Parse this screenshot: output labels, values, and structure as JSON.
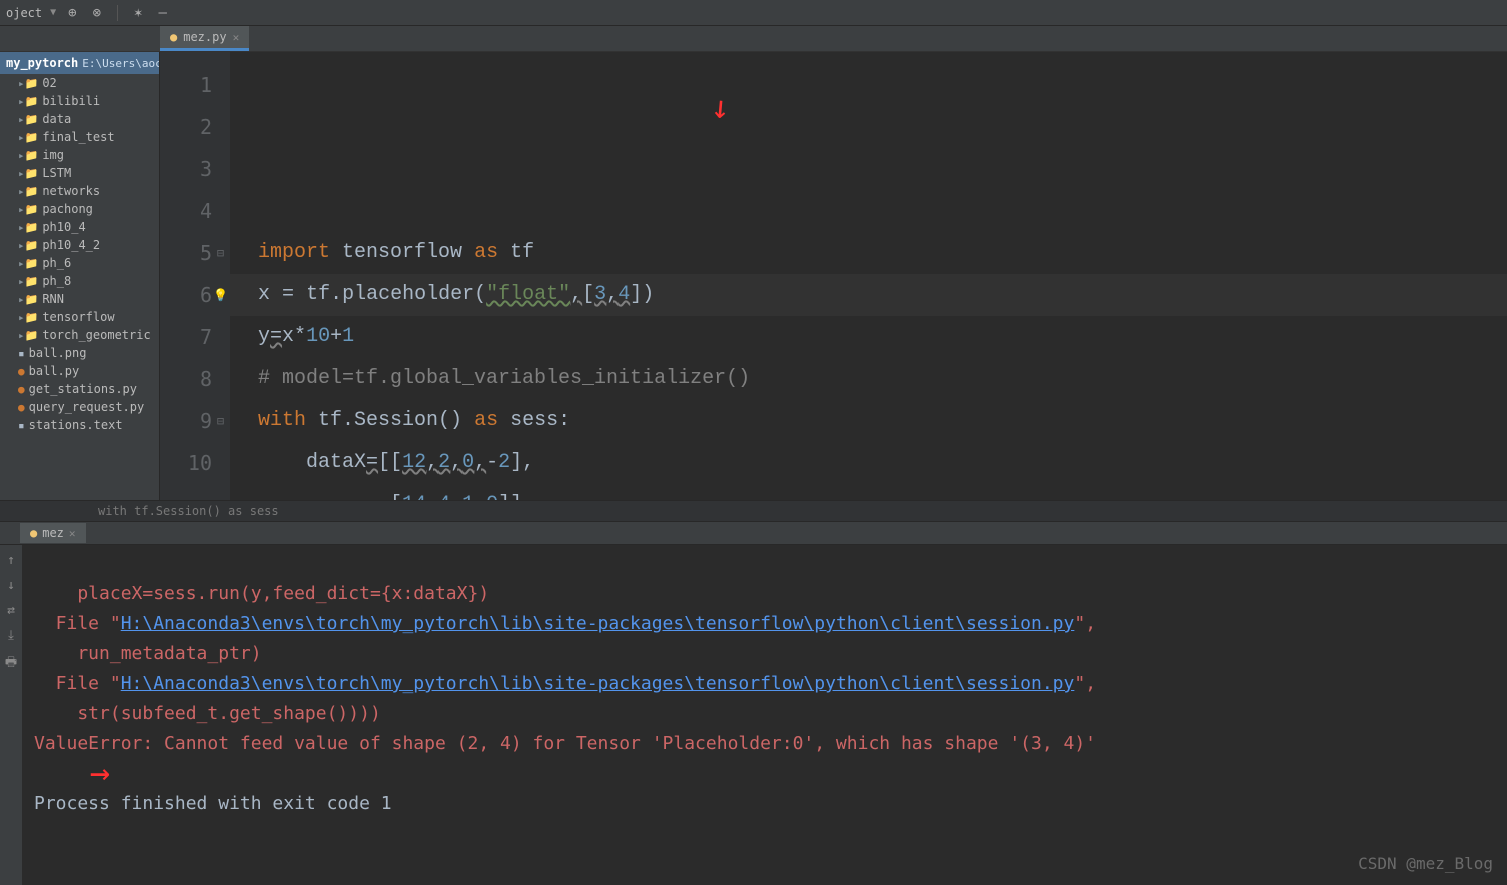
{
  "toolbar": {
    "project_label": "oject"
  },
  "tab": {
    "filename": "mez.py"
  },
  "project_tree": {
    "root_name": "my_pytorch",
    "root_path": "E:\\Users\\aoc\\Py",
    "items": [
      {
        "type": "folder",
        "label": "02"
      },
      {
        "type": "folder",
        "label": "bilibili"
      },
      {
        "type": "folder",
        "label": "data"
      },
      {
        "type": "folder",
        "label": "final_test"
      },
      {
        "type": "folder",
        "label": "img"
      },
      {
        "type": "folder",
        "label": "LSTM"
      },
      {
        "type": "folder",
        "label": "networks"
      },
      {
        "type": "folder",
        "label": "pachong"
      },
      {
        "type": "folder",
        "label": "ph10_4"
      },
      {
        "type": "folder",
        "label": "ph10_4_2"
      },
      {
        "type": "folder",
        "label": "ph_6"
      },
      {
        "type": "folder",
        "label": "ph_8"
      },
      {
        "type": "folder",
        "label": "RNN"
      },
      {
        "type": "folder",
        "label": "tensorflow"
      },
      {
        "type": "folder",
        "label": "torch_geometric"
      },
      {
        "type": "file",
        "label": "ball.png"
      },
      {
        "type": "pyfile",
        "label": "ball.py"
      },
      {
        "type": "pyfile",
        "label": "get_stations.py"
      },
      {
        "type": "pyfile",
        "label": "query_request.py"
      },
      {
        "type": "file",
        "label": "stations.text"
      }
    ]
  },
  "code": {
    "line_numbers": [
      "1",
      "2",
      "3",
      "4",
      "5",
      "6",
      "7",
      "8",
      "9",
      "10"
    ],
    "context": "with tf.Session() as sess"
  },
  "console": {
    "tab_name": "mez",
    "line0": "    placeX=sess.run(y,feed_dict={x:dataX})",
    "file_prefix": "  File \"",
    "link1": "H:\\Anaconda3\\envs\\torch\\my_pytorch\\lib\\site-packages\\tensorflow\\python\\client\\session.py",
    "detail1": "    run_metadata_ptr)",
    "link2": "H:\\Anaconda3\\envs\\torch\\my_pytorch\\lib\\site-packages\\tensorflow\\python\\client\\session.py",
    "detail2": "    str(subfeed_t.get_shape())))",
    "error_line": "ValueError: Cannot feed value of shape (2, 4) for Tensor 'Placeholder:0', which has shape '(3, 4)'",
    "exit_line": "Process finished with exit code 1",
    "file_suffix": "\","
  },
  "watermark": "CSDN @mez_Blog"
}
